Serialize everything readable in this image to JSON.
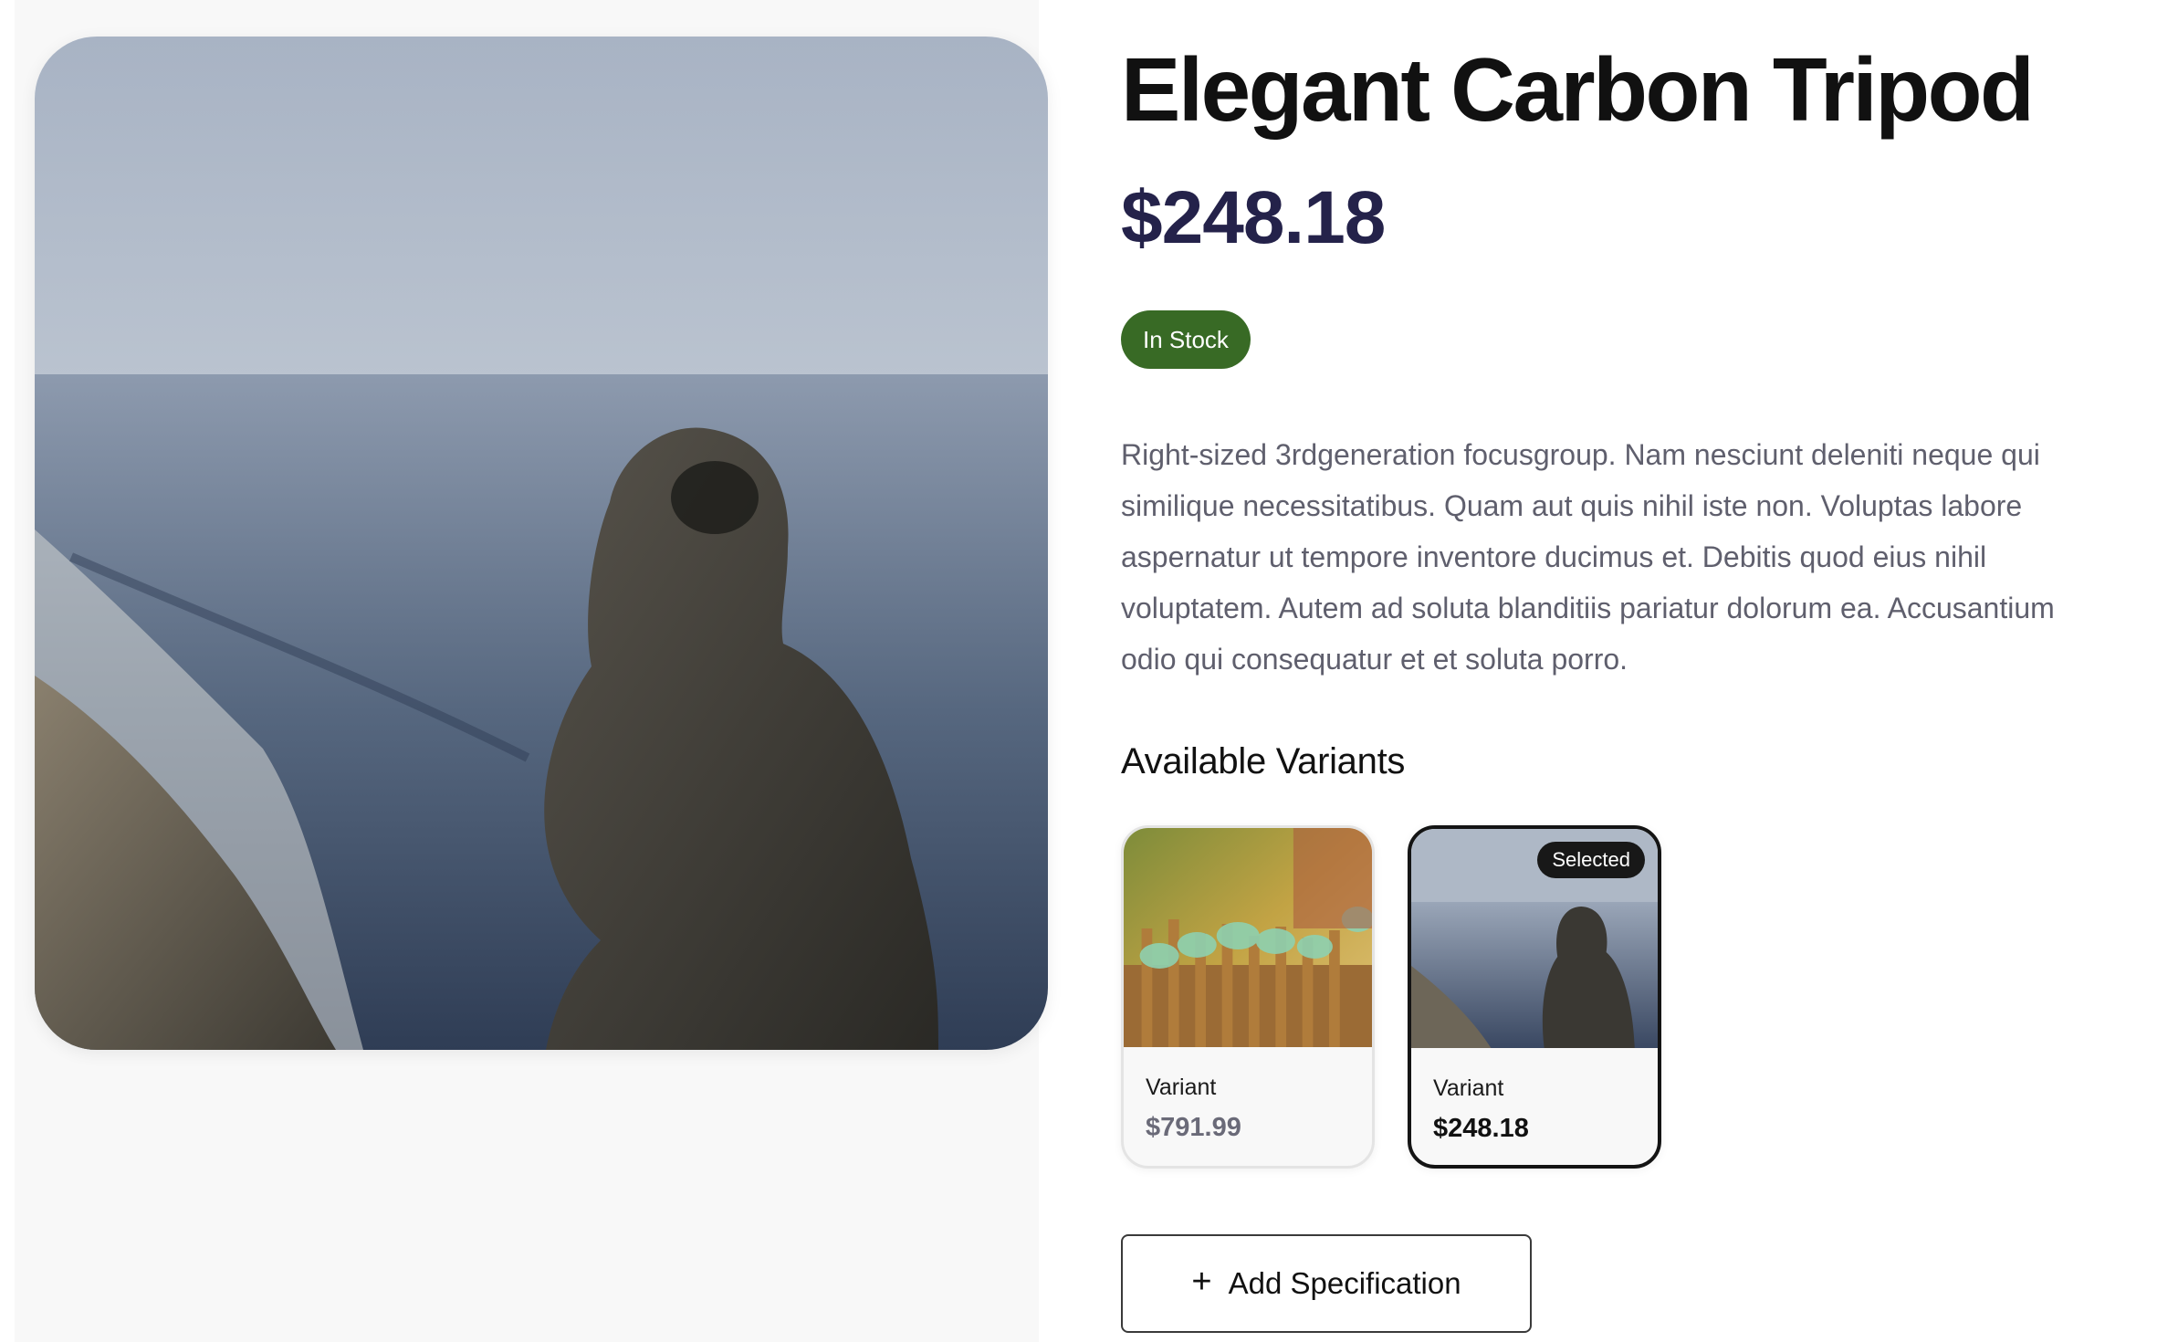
{
  "product": {
    "title": "Elegant Carbon Tripod",
    "price": "$248.18",
    "stock_status": "In Stock",
    "description": "Right-sized 3rdgeneration focusgroup. Nam nesciunt deleniti neque qui similique necessitatibus. Quam aut quis nihil iste non. Voluptas labore aspernatur ut tempore inventore ducimus et. Debitis quod eius nihil voluptatem. Autem ad soluta blanditiis pariatur dolorum ea. Accusantium odio qui consequatur et et soluta porro."
  },
  "variants": {
    "heading": "Available Variants",
    "items": [
      {
        "label": "Variant",
        "price": "$791.99",
        "selected": false
      },
      {
        "label": "Variant",
        "price": "$248.18",
        "selected": true,
        "selected_tag": "Selected"
      }
    ]
  },
  "actions": {
    "add_spec_label": "Add Specification",
    "add_spec_icon": "plus-icon"
  },
  "colors": {
    "price": "#24224a",
    "in_stock": "#386a25",
    "description_text": "#5f5f6d"
  }
}
